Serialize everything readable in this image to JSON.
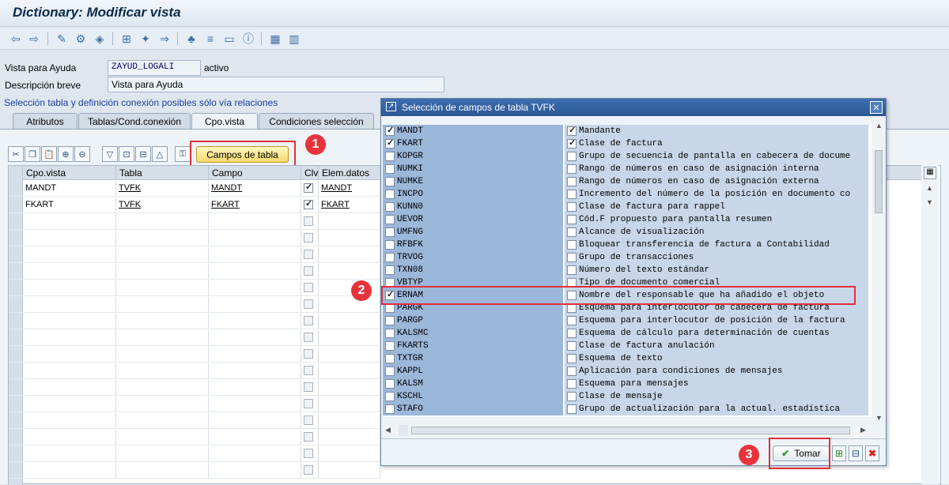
{
  "window": {
    "title": "Dictionary: Modificar vista"
  },
  "toolbar": {
    "icons": [
      "back-icon",
      "forward-icon",
      "other-object-icon",
      "display-change-icon",
      "activate-icon",
      "where-used-icon",
      "check-icon",
      "object-list-icon",
      "hierarchy-icon",
      "navigation-icon",
      "text-icon",
      "info-icon",
      "table-icon",
      "grid-icon"
    ]
  },
  "header": {
    "vista_label": "Vista para Ayuda",
    "vista_value": "ZAYUD_LOGALI",
    "status": "activo",
    "desc_label": "Descripción breve",
    "desc_value": "Vista para Ayuda",
    "info_text": "Selección tabla y definición conexión posibles sólo vía relaciones"
  },
  "tabs": [
    {
      "label": "Atributos"
    },
    {
      "label": "Tablas/Cond.conexión"
    },
    {
      "label": "Cpo.vista"
    },
    {
      "label": "Condiciones selección"
    }
  ],
  "campos_button": {
    "label": "Campos de tabla"
  },
  "annotations": [
    "1",
    "2",
    "3"
  ],
  "grid": {
    "columns": [
      "Cpo.vista",
      "Tabla",
      "Campo",
      "Clv",
      "Elem.datos"
    ],
    "rows": [
      {
        "cpo": "MANDT",
        "tabla": "TVFK",
        "campo": "MANDT",
        "clv": true,
        "elem": "MANDT"
      },
      {
        "cpo": "FKART",
        "tabla": "TVFK",
        "campo": "FKART",
        "clv": true,
        "elem": "FKART"
      }
    ]
  },
  "dialog": {
    "title": "Selección de campos de tabla TVFK",
    "fields": [
      {
        "name": "MANDT",
        "desc": "Mandante",
        "sel1": true,
        "sel2": true
      },
      {
        "name": "FKART",
        "desc": "Clase de factura",
        "sel1": true,
        "sel2": true
      },
      {
        "name": "KOPGR",
        "desc": "Grupo de secuencia de pantalla en cabecera de docume",
        "sel1": false,
        "sel2": false
      },
      {
        "name": "NUMKI",
        "desc": "Rango de números en caso de asignación interna",
        "sel1": false,
        "sel2": false
      },
      {
        "name": "NUMKE",
        "desc": "Rango de números en caso de asignación externa",
        "sel1": false,
        "sel2": false
      },
      {
        "name": "INCPO",
        "desc": "Incremento del número de la posición en documento co",
        "sel1": false,
        "sel2": false
      },
      {
        "name": "KUNN0",
        "desc": "Clase de factura para rappel",
        "sel1": false,
        "sel2": false
      },
      {
        "name": "UEVOR",
        "desc": "Cód.F propuesto para pantalla resumen",
        "sel1": false,
        "sel2": false
      },
      {
        "name": "UMFNG",
        "desc": "Alcance de visualización",
        "sel1": false,
        "sel2": false
      },
      {
        "name": "RFBFK",
        "desc": "Bloquear transferencia de factura a Contabilidad",
        "sel1": false,
        "sel2": false
      },
      {
        "name": "TRVOG",
        "desc": "Grupo de transacciones",
        "sel1": false,
        "sel2": false
      },
      {
        "name": "TXN08",
        "desc": "Número del texto estándar",
        "sel1": false,
        "sel2": false
      },
      {
        "name": "VBTYP",
        "desc": "Tipo de documento comercial",
        "sel1": false,
        "sel2": false
      },
      {
        "name": "ERNAM",
        "desc": "Nombre del responsable que ha añadido el objeto",
        "sel1": true,
        "sel2": false
      },
      {
        "name": "PARGK",
        "desc": "Esquema para interlocutor de cabecera de factura",
        "sel1": false,
        "sel2": false
      },
      {
        "name": "PARGP",
        "desc": "Esquema para interlocutor de posición de la factura",
        "sel1": false,
        "sel2": false
      },
      {
        "name": "KALSMC",
        "desc": "Esquema de cálculo para determinación de cuentas",
        "sel1": false,
        "sel2": false
      },
      {
        "name": "FKARTS",
        "desc": "Clase de factura anulación",
        "sel1": false,
        "sel2": false
      },
      {
        "name": "TXTGR",
        "desc": "Esquema de texto",
        "sel1": false,
        "sel2": false
      },
      {
        "name": "KAPPL",
        "desc": "Aplicación para condiciones de mensajes",
        "sel1": false,
        "sel2": false
      },
      {
        "name": "KALSM",
        "desc": "Esquema para mensajes",
        "sel1": false,
        "sel2": false
      },
      {
        "name": "KSCHL",
        "desc": "Clase de mensaje",
        "sel1": false,
        "sel2": false
      },
      {
        "name": "STAFO",
        "desc": "Grupo de actualización para la actual. estadística",
        "sel1": false,
        "sel2": false
      }
    ],
    "tomar_label": "Tomar"
  },
  "colors": {
    "accent_red": "#e8333c",
    "dialog_title": "#2c5794"
  }
}
